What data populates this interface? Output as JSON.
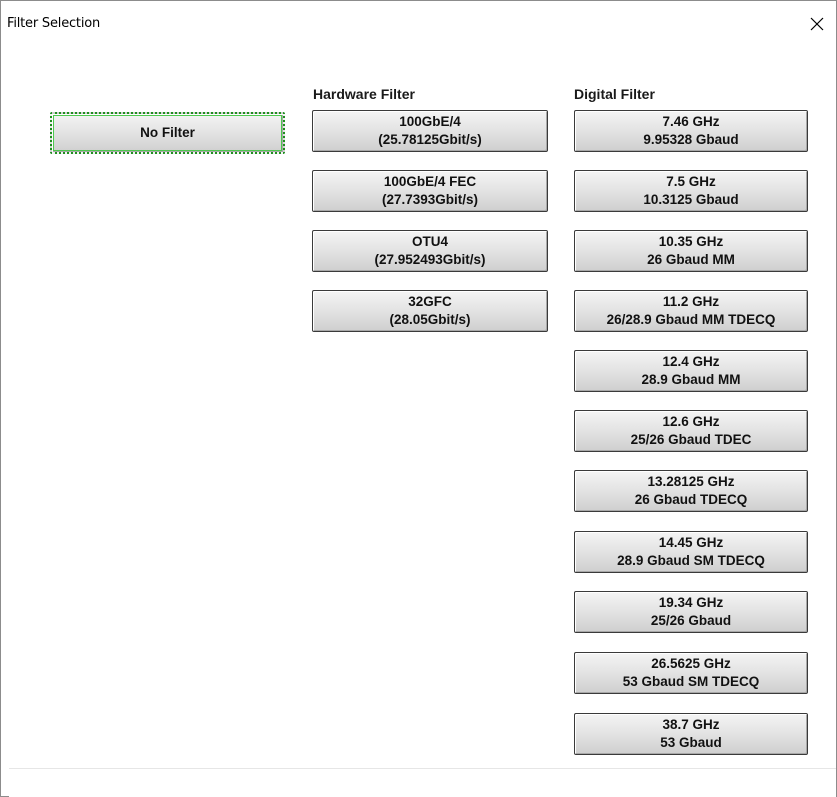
{
  "window": {
    "title": "Filter Selection",
    "close_icon": "close-icon",
    "close_glyph": "✕"
  },
  "no_filter": {
    "label": "No Filter",
    "selected": true
  },
  "hardware": {
    "title": "Hardware Filter",
    "buttons": [
      {
        "line1": "100GbE/4",
        "line2": "(25.78125Gbit/s)"
      },
      {
        "line1": "100GbE/4 FEC",
        "line2": "(27.7393Gbit/s)"
      },
      {
        "line1": "OTU4",
        "line2": "(27.952493Gbit/s)"
      },
      {
        "line1": "32GFC",
        "line2": "(28.05Gbit/s)"
      }
    ]
  },
  "digital": {
    "title": "Digital Filter",
    "buttons": [
      {
        "line1": "7.46 GHz",
        "line2": "9.95328 Gbaud"
      },
      {
        "line1": "7.5 GHz",
        "line2": "10.3125 Gbaud"
      },
      {
        "line1": "10.35 GHz",
        "line2": "26 Gbaud MM"
      },
      {
        "line1": "11.2 GHz",
        "line2": "26/28.9 Gbaud MM TDECQ"
      },
      {
        "line1": "12.4 GHz",
        "line2": "28.9 Gbaud MM"
      },
      {
        "line1": "12.6 GHz",
        "line2": "25/26 Gbaud TDEC"
      },
      {
        "line1": "13.28125 GHz",
        "line2": "26 Gbaud TDECQ"
      },
      {
        "line1": "14.45 GHz",
        "line2": "28.9 Gbaud SM TDECQ"
      },
      {
        "line1": "19.34 GHz",
        "line2": "25/26 Gbaud"
      },
      {
        "line1": "26.5625 GHz",
        "line2": "53 Gbaud SM TDECQ"
      },
      {
        "line1": "38.7 GHz",
        "line2": "53 Gbaud"
      }
    ]
  }
}
